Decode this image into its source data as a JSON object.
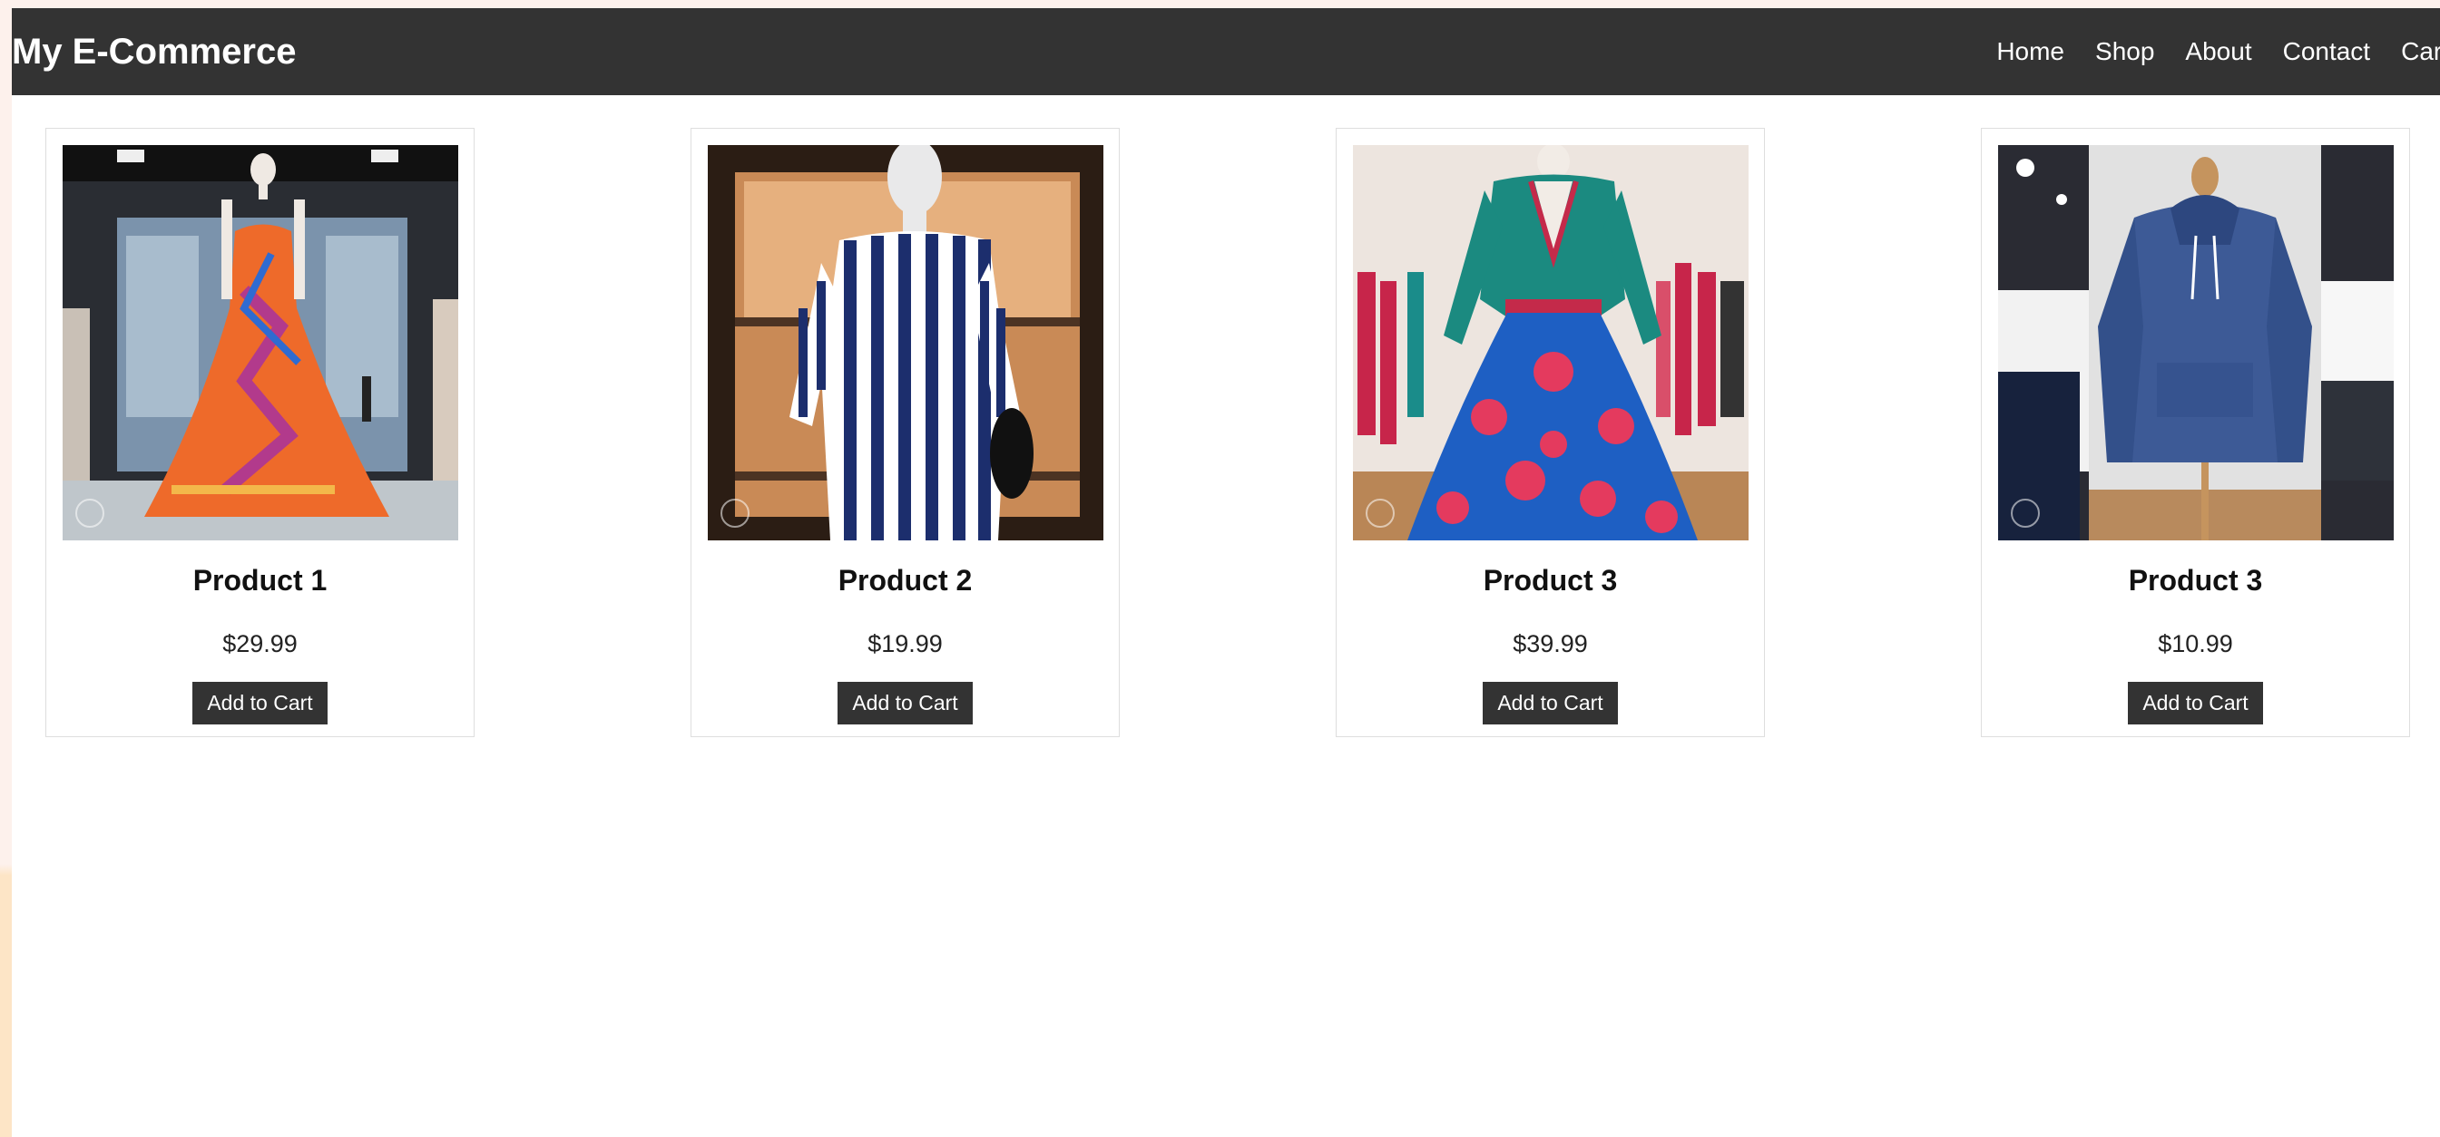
{
  "brand": "My E-Commerce",
  "nav": [
    "Home",
    "Shop",
    "About",
    "Contact",
    "Cart"
  ],
  "products": [
    {
      "title": "Product 1",
      "price": "$29.99",
      "button": "Add to Cart",
      "image": "mannequin-orange-gown"
    },
    {
      "title": "Product 2",
      "price": "$19.99",
      "button": "Add to Cart",
      "image": "mannequin-striped-shirt"
    },
    {
      "title": "Product 3",
      "price": "$39.99",
      "button": "Add to Cart",
      "image": "mannequin-blue-floral-dress"
    },
    {
      "title": "Product 3",
      "price": "$10.99",
      "button": "Add to Cart",
      "image": "mannequin-blue-hoodie"
    }
  ],
  "colors": {
    "navbar": "#333333",
    "button": "#333333"
  }
}
